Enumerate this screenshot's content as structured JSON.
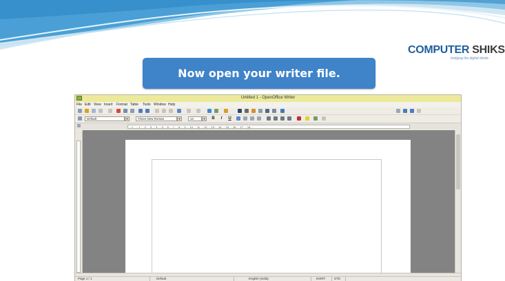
{
  "slide": {
    "banner_text": "Now open your writer file.",
    "logo_part1": "COMPUTER",
    "logo_part2": " SHIKSHA",
    "logo_tagline": "bridging the digital divide"
  },
  "app": {
    "window_title": "Untitled 1 - OpenOffice Writer",
    "menu": [
      "File",
      "Edit",
      "View",
      "Insert",
      "Format",
      "Table",
      "Tools",
      "Window",
      "Help"
    ],
    "find_placeholder": "Find",
    "paragraph_style": "Default",
    "font_name": "Times New Roman",
    "font_size": "12",
    "ruler_text": "· · 1 · · · 1 · · 2 · · 3 · · 4 · · 5 · · 6 · · 7 · · 8 · · 9 · · 10 · · 11 · · 12 · · 13 · · 14 · · 15 · · 16 · · 17 · · 18 · ·",
    "status": {
      "page": "Page 1 / 1",
      "style": "Default",
      "language": "English (India)",
      "insert_mode": "INSRT",
      "selection_mode": "STD"
    }
  },
  "colors": {
    "banner": "#3f83c9",
    "titlebar": "#ece99a",
    "document_background": "#838383"
  }
}
